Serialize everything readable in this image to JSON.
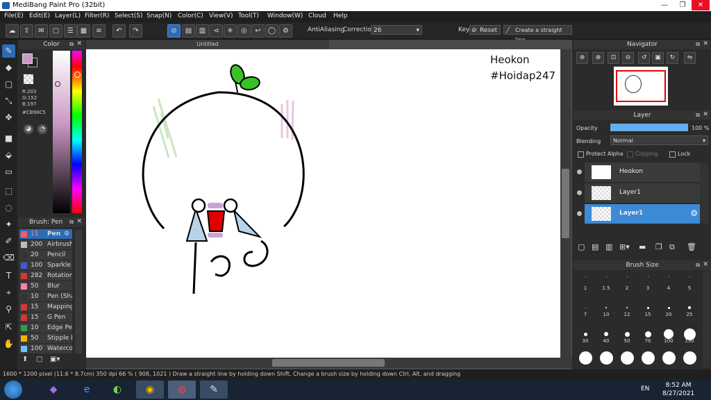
{
  "window": {
    "title": "MediBang Paint Pro (32bit)",
    "min": "—",
    "max": "❐",
    "close": "✕"
  },
  "menu": [
    "File(E)",
    "Edit(E)",
    "Layer(L)",
    "Filter(R)",
    "Select(S)",
    "Snap(N)",
    "Color(C)",
    "View(V)",
    "Tool(T)",
    "Window(W)",
    "Cloud",
    "Help"
  ],
  "toolbar": {
    "antialiasing_label": "AntiAliasing",
    "correction_label": "Correction",
    "correction_value": "26",
    "key_label": "Key",
    "reset_label": "Reset",
    "straight_line_label": "Create a straight line"
  },
  "color_panel": {
    "title": "Color",
    "r": "R:203",
    "g": "G:152",
    "b": "B:197",
    "hex": "#CB98C5",
    "fg_color": "#CB98C5"
  },
  "brush_panel": {
    "title": "Brush: Pen",
    "items": [
      {
        "size": "15",
        "name": "Pen",
        "color": "#ff5a5a"
      },
      {
        "size": "200",
        "name": "Airbrush",
        "color": "#bbbbbb"
      },
      {
        "size": "20",
        "name": "Pencil",
        "color": "#333333"
      },
      {
        "size": "100",
        "name": "Sparkle E",
        "color": "#3b5bdb"
      },
      {
        "size": "282",
        "name": "Rotation",
        "color": "#e03131"
      },
      {
        "size": "50",
        "name": "Blur",
        "color": "#f783ac"
      },
      {
        "size": "10",
        "name": "Pen (Sha",
        "color": "#333333"
      },
      {
        "size": "15",
        "name": "Mapping",
        "color": "#e03131"
      },
      {
        "size": "15",
        "name": "G Pen",
        "color": "#e03131"
      },
      {
        "size": "10",
        "name": "Edge Pen",
        "color": "#2f9e44"
      },
      {
        "size": "50",
        "name": "Stipple P",
        "color": "#fab005"
      },
      {
        "size": "100",
        "name": "Waterco",
        "color": "#74c0fc"
      }
    ]
  },
  "document": {
    "tab": "Untitled"
  },
  "canvas_text": {
    "line1": "Heokon",
    "line2": "#Hoidap247"
  },
  "navigator": {
    "title": "Navigator"
  },
  "layer_panel": {
    "title": "Layer",
    "opacity_label": "Opacity",
    "opacity_value": "100 %",
    "opacity_fraction": 1.0,
    "blending_label": "Blending",
    "blending_value": "Normal",
    "protect_alpha": "Protect Alpha",
    "clipping": "Clipping",
    "lock": "Lock",
    "layers": [
      {
        "name": "Heokon",
        "selected": false
      },
      {
        "name": "Layer1",
        "selected": false
      },
      {
        "name": "Layer1",
        "selected": true
      }
    ]
  },
  "brush_size": {
    "title": "Brush Size",
    "sizes": [
      "1",
      "1.5",
      "2",
      "3",
      "4",
      "5",
      "7",
      "10",
      "12",
      "15",
      "20",
      "25",
      "30",
      "40",
      "50",
      "70",
      "100",
      "150"
    ]
  },
  "status": "1600 * 1200 pixel   (11.6 * 8.7cm)   350 dpi   66 %   ( 908, 1021 )   Draw a straight line by holding down Shift, Change a brush size by holding down Ctrl, Alt, and dragging",
  "taskbar": {
    "lang": "EN",
    "time": "8:52 AM",
    "date": "8/27/2021"
  }
}
